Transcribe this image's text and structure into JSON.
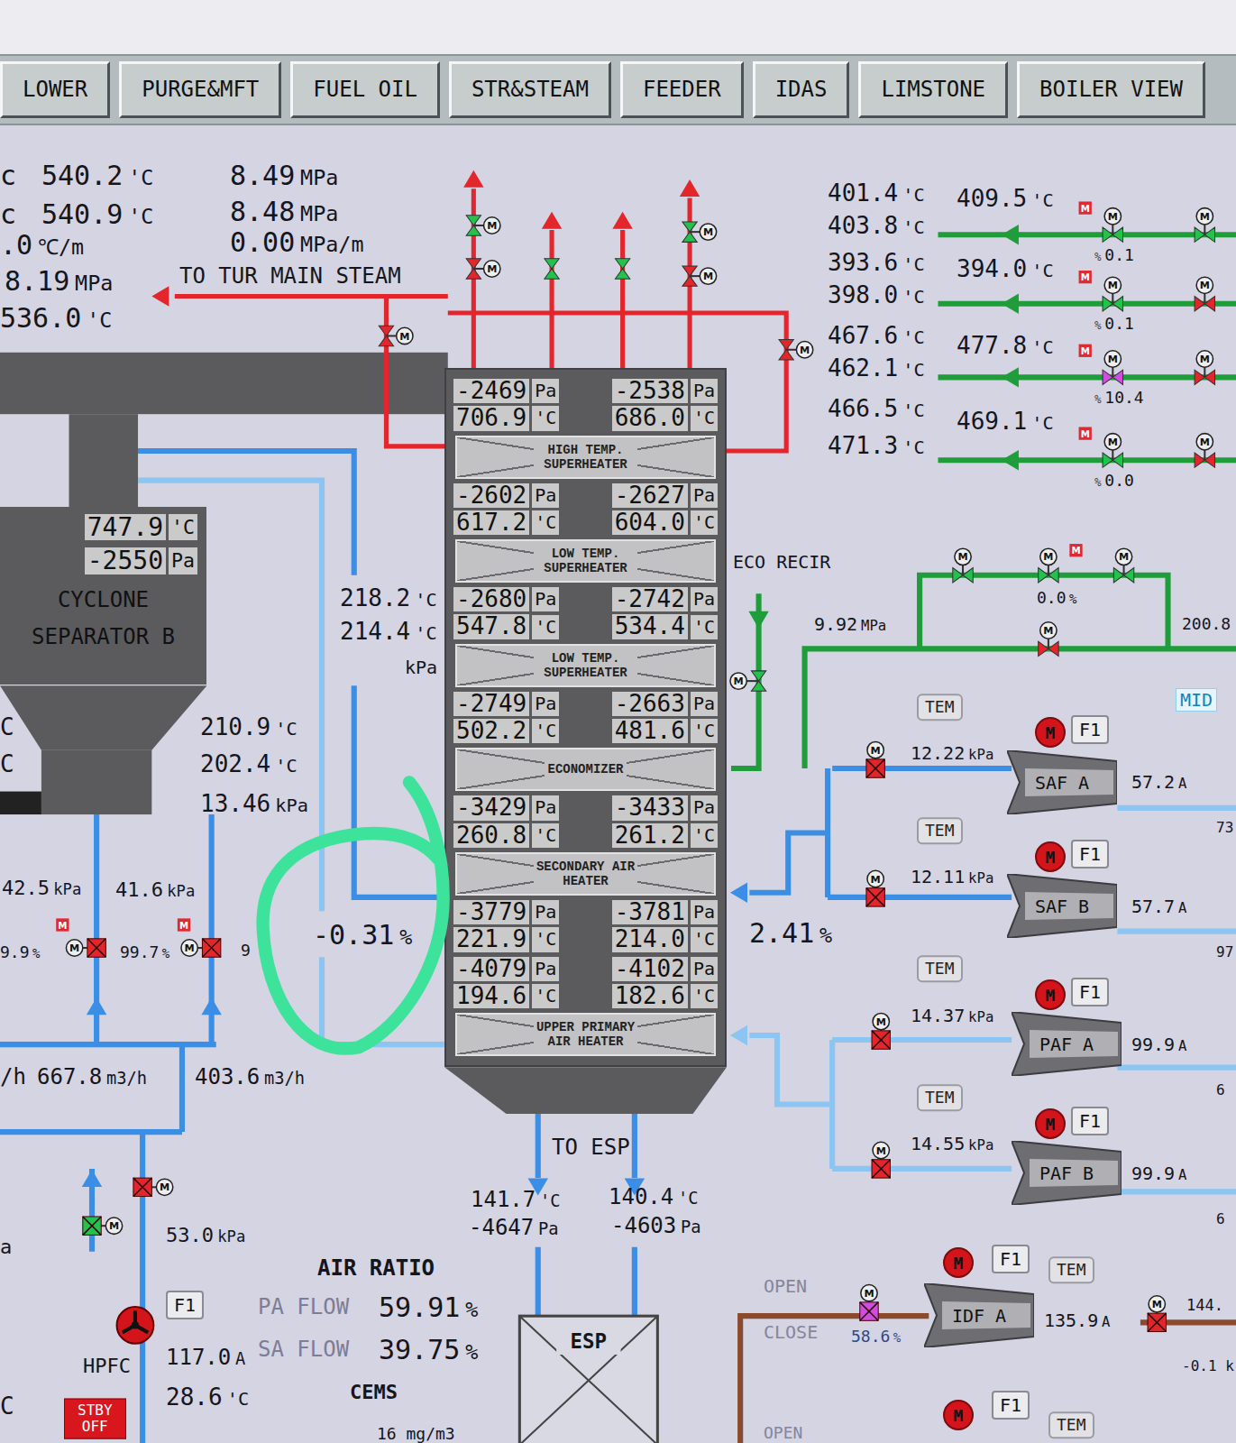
{
  "tabs": [
    {
      "label": "LOWER",
      "selected": false
    },
    {
      "label": "PURGE&MFT",
      "selected": false
    },
    {
      "label": "FUEL OIL",
      "selected": false
    },
    {
      "label": "STR&STEAM",
      "selected": false
    },
    {
      "label": "FEEDER",
      "selected": false
    },
    {
      "label": "IDAS",
      "selected": false
    },
    {
      "label": "LIMSTONE",
      "selected": false
    },
    {
      "label": "BOILER VIEW",
      "selected": false
    }
  ],
  "valve_mark": "M",
  "main_steam": {
    "label": "TO TUR MAIN STEAM",
    "readings": [
      {
        "value": "540.2",
        "unit": "'C"
      },
      {
        "value": "8.49",
        "unit": "MPa"
      },
      {
        "value": "540.9",
        "unit": "'C"
      },
      {
        "value": "8.48",
        "unit": "MPa"
      },
      {
        "value": ".0",
        "unit": "℃/m"
      },
      {
        "value": "0.00",
        "unit": "MPa/m"
      },
      {
        "value": "8.19",
        "unit": "MPa"
      },
      {
        "value": "536.0",
        "unit": "'C"
      }
    ]
  },
  "steam_valves": [
    {
      "color": "#22c24c"
    },
    {
      "color": "#e3262c"
    },
    {
      "color": "#22c24c"
    },
    {
      "color": "#22c24c"
    },
    {
      "color": "#22c24c"
    },
    {
      "color": "#e3262c"
    },
    {
      "color": "#e3262c"
    },
    {
      "color": "#e3262c"
    }
  ],
  "cyclone": {
    "temp": {
      "value": "747.9",
      "unit": "'C"
    },
    "pressure": {
      "value": "-2550",
      "unit": "Pa"
    },
    "name": "CYCLONE SEPARATOR B"
  },
  "tower": [
    {
      "kind": "readings",
      "left": [
        {
          "value": "-2469",
          "unit": "Pa"
        },
        {
          "value": "706.9",
          "unit": "'C"
        }
      ],
      "right": [
        {
          "value": "-2538",
          "unit": "Pa"
        },
        {
          "value": "686.0",
          "unit": "'C"
        }
      ]
    },
    {
      "kind": "section",
      "label": "HIGH TEMP. SUPERHEATER"
    },
    {
      "kind": "readings",
      "left": [
        {
          "value": "-2602",
          "unit": "Pa"
        },
        {
          "value": "617.2",
          "unit": "'C"
        }
      ],
      "right": [
        {
          "value": "-2627",
          "unit": "Pa"
        },
        {
          "value": "604.0",
          "unit": "'C"
        }
      ]
    },
    {
      "kind": "section",
      "label": "LOW TEMP. SUPERHEATER"
    },
    {
      "kind": "readings",
      "left": [
        {
          "value": "-2680",
          "unit": "Pa"
        },
        {
          "value": "547.8",
          "unit": "'C"
        }
      ],
      "right": [
        {
          "value": "-2742",
          "unit": "Pa"
        },
        {
          "value": "534.4",
          "unit": "'C"
        }
      ]
    },
    {
      "kind": "section",
      "label": "LOW TEMP. SUPERHEATER"
    },
    {
      "kind": "readings",
      "left": [
        {
          "value": "-2749",
          "unit": "Pa"
        },
        {
          "value": "502.2",
          "unit": "'C"
        }
      ],
      "right": [
        {
          "value": "-2663",
          "unit": "Pa"
        },
        {
          "value": "481.6",
          "unit": "'C"
        }
      ]
    },
    {
      "kind": "section",
      "label": "ECONOMIZER"
    },
    {
      "kind": "readings",
      "left": [
        {
          "value": "-3429",
          "unit": "Pa"
        },
        {
          "value": "260.8",
          "unit": "'C"
        }
      ],
      "right": [
        {
          "value": "-3433",
          "unit": "Pa"
        },
        {
          "value": "261.2",
          "unit": "'C"
        }
      ]
    },
    {
      "kind": "section",
      "label": "SECONDARY AIR HEATER"
    },
    {
      "kind": "readings",
      "left": [
        {
          "value": "-3779",
          "unit": "Pa"
        },
        {
          "value": "221.9",
          "unit": "'C"
        }
      ],
      "right": [
        {
          "value": "-3781",
          "unit": "Pa"
        },
        {
          "value": "214.0",
          "unit": "'C"
        }
      ]
    },
    {
      "kind": "readings",
      "left": [
        {
          "value": "-4079",
          "unit": "Pa"
        },
        {
          "value": "194.6",
          "unit": "'C"
        }
      ],
      "right": [
        {
          "value": "-4102",
          "unit": "Pa"
        },
        {
          "value": "182.6",
          "unit": "'C"
        }
      ]
    },
    {
      "kind": "section",
      "label": "UPPER PRIMARY AIR HEATER"
    }
  ],
  "loop_readings": [
    {
      "value": "218.2",
      "unit": "'C"
    },
    {
      "value": "214.4",
      "unit": "'C"
    },
    {
      "value": "210.9",
      "unit": "'C"
    },
    {
      "value": "202.4",
      "unit": "'C"
    },
    {
      "value": "13.46",
      "unit": "kPa"
    },
    {
      "value": "42.5",
      "unit": "kPa"
    },
    {
      "value": "41.6",
      "unit": "kPa"
    },
    {
      "value": "9.9",
      "unit": "%"
    },
    {
      "value": "99.7",
      "unit": "%"
    },
    {
      "value": "-0.31",
      "unit": "%"
    },
    {
      "value": "2.41",
      "unit": "%"
    },
    {
      "value": "667.8",
      "unit": "m3/h"
    },
    {
      "value": "403.6",
      "unit": "m3/h"
    },
    {
      "value": "53.0",
      "unit": "kPa"
    },
    {
      "value": "141.7",
      "unit": "'C"
    },
    {
      "value": "-4647",
      "unit": "Pa"
    },
    {
      "value": "140.4",
      "unit": "'C"
    },
    {
      "value": "-4603",
      "unit": "Pa"
    }
  ],
  "fragments": [
    {
      "text": "c"
    },
    {
      "text": "c"
    },
    {
      "text": "kPa"
    },
    {
      "text": "C"
    },
    {
      "text": "C"
    },
    {
      "text": "/h"
    },
    {
      "text": "9"
    },
    {
      "text": "a"
    },
    {
      "text": "C"
    },
    {
      "text": "200.8"
    }
  ],
  "left_dampers": [
    {
      "color": "#e3262c"
    },
    {
      "color": "#e3262c"
    },
    {
      "color": "#e3262c"
    },
    {
      "color": "#22c24c"
    }
  ],
  "esp": {
    "label": "TO ESP",
    "name": "ESP"
  },
  "air_ratio": {
    "title": "AIR RATIO",
    "rows": [
      {
        "label": "PA FLOW",
        "value": "59.91",
        "unit": "%"
      },
      {
        "label": "SA FLOW",
        "value": "39.75",
        "unit": "%"
      }
    ],
    "cems_title": "CEMS",
    "cems_value": "16 mg/m3"
  },
  "hpfc": {
    "f1": "F1",
    "name": "HPFC",
    "current": {
      "value": "117.0",
      "unit": "A"
    },
    "temp": {
      "value": "28.6",
      "unit": "'C"
    },
    "status": "STBY OFF"
  },
  "superheater_lines": [
    {
      "inlet": [
        {
          "value": "401.4",
          "unit": "'C"
        },
        {
          "value": "403.8",
          "unit": "'C"
        }
      ],
      "outlet": {
        "value": "409.5",
        "unit": "'C"
      },
      "valve": {
        "mark": "%",
        "value": "0.1"
      },
      "valve_color": "#22c24c",
      "end_color": "#22c24c"
    },
    {
      "inlet": [
        {
          "value": "393.6",
          "unit": "'C"
        },
        {
          "value": "398.0",
          "unit": "'C"
        }
      ],
      "outlet": {
        "value": "394.0",
        "unit": "'C"
      },
      "valve": {
        "mark": "%",
        "value": "0.1"
      },
      "valve_color": "#22c24c",
      "end_color": "#e3262c"
    },
    {
      "inlet": [
        {
          "value": "467.6",
          "unit": "'C"
        },
        {
          "value": "462.1",
          "unit": "'C"
        }
      ],
      "outlet": {
        "value": "477.8",
        "unit": "'C"
      },
      "valve": {
        "mark": "%",
        "value": "10.4"
      },
      "valve_color": "#d04de0",
      "end_color": "#e3262c"
    },
    {
      "inlet": [
        {
          "value": "466.5",
          "unit": "'C"
        },
        {
          "value": "471.3",
          "unit": "'C"
        }
      ],
      "outlet": {
        "value": "469.1",
        "unit": "'C"
      },
      "valve": {
        "mark": "%",
        "value": "0.0"
      },
      "valve_color": "#22c24c",
      "end_color": "#e3262c"
    }
  ],
  "eco": {
    "label": "ECO RECIR",
    "pressure": {
      "value": "9.92",
      "unit": "MPa"
    },
    "valve_reading": {
      "value": "0.0",
      "unit": "%"
    },
    "mode": "MID",
    "valves": [
      {
        "color": "#22c24c"
      },
      {
        "color": "#22c24c"
      },
      {
        "color": "#22c24c"
      },
      {
        "color": "#e3262c"
      },
      {
        "color": "#22c24c"
      }
    ]
  },
  "fans": [
    {
      "name": "SAF A",
      "outlet": {
        "value": "12.22",
        "unit": "kPa"
      },
      "current": {
        "value": "57.2",
        "unit": "A"
      },
      "tem": "TEM",
      "motor": "M",
      "f1": "F1",
      "edge": "73"
    },
    {
      "name": "SAF B",
      "outlet": {
        "value": "12.11",
        "unit": "kPa"
      },
      "current": {
        "value": "57.7",
        "unit": "A"
      },
      "tem": "TEM",
      "motor": "M",
      "f1": "F1",
      "edge": "97"
    },
    {
      "name": "PAF A",
      "outlet": {
        "value": "14.37",
        "unit": "kPa"
      },
      "current": {
        "value": "99.9",
        "unit": "A"
      },
      "tem": "TEM",
      "motor": "M",
      "f1": "F1",
      "edge": "6"
    },
    {
      "name": "PAF B",
      "outlet": {
        "value": "14.55",
        "unit": "kPa"
      },
      "current": {
        "value": "99.9",
        "unit": "A"
      },
      "tem": "TEM",
      "motor": "M",
      "f1": "F1",
      "edge": "6"
    }
  ],
  "fan_dampers": [
    {
      "color": "#e3262c"
    },
    {
      "color": "#e3262c"
    },
    {
      "color": "#e3262c"
    },
    {
      "color": "#e3262c"
    }
  ],
  "idf": {
    "open": "OPEN",
    "close": "CLOSE",
    "name": "IDF A",
    "damper": {
      "value": "58.6",
      "unit": "%"
    },
    "damper_color": "#d04de0",
    "outlet_damper_color": "#e3262c",
    "current": {
      "value": "135.9",
      "unit": "A"
    },
    "tem": "TEM",
    "motor": "M",
    "f1": "F1",
    "outlet": "144.",
    "draft": "-0.1 k"
  },
  "idf_next": {
    "open": "OPEN",
    "motor": "M",
    "f1": "F1",
    "tem": "TEM"
  }
}
